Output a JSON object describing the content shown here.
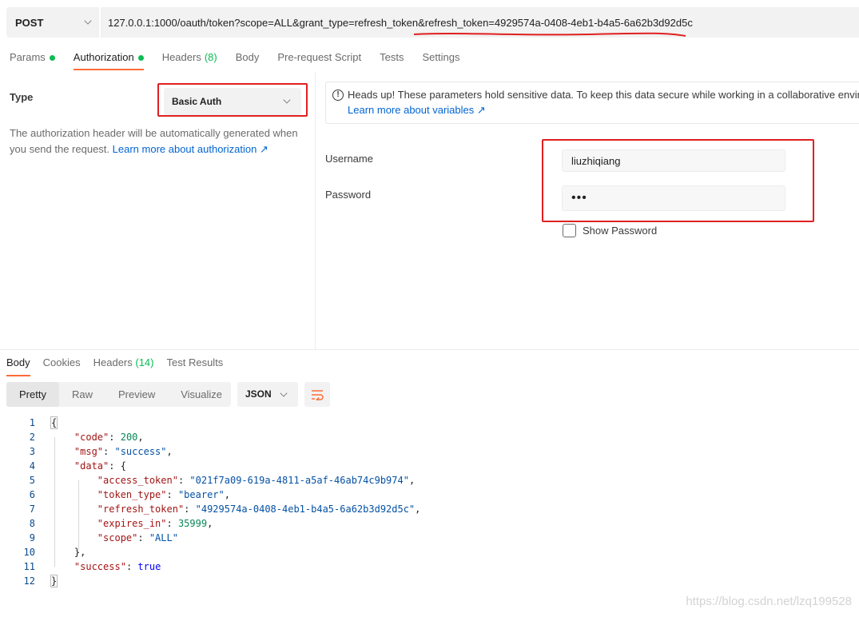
{
  "request": {
    "method": "POST",
    "url": "127.0.0.1:1000/oauth/token?scope=ALL&grant_type=refresh_token&refresh_token=4929574a-0408-4eb1-b4a5-6a62b3d92d5c"
  },
  "request_tabs": [
    {
      "label": "Params",
      "dot": true
    },
    {
      "label": "Authorization",
      "dot": true,
      "active": true
    },
    {
      "label": "Headers",
      "count": "(8)"
    },
    {
      "label": "Body"
    },
    {
      "label": "Pre-request Script"
    },
    {
      "label": "Tests"
    },
    {
      "label": "Settings"
    }
  ],
  "auth": {
    "type_label": "Type",
    "type_value": "Basic Auth",
    "description": "The authorization header will be automatically generated when you send the request.",
    "description_link": "Learn more about authorization ↗",
    "notice_text": "Heads up! These parameters hold sensitive data. To keep this data secure while working in a collaborative enviro",
    "notice_link": "Learn more about variables ↗",
    "username_label": "Username",
    "username_value": "liuzhiqiang",
    "password_label": "Password",
    "password_value": "•••",
    "show_password_label": "Show Password"
  },
  "response_tabs": [
    {
      "label": "Body",
      "active": true
    },
    {
      "label": "Cookies"
    },
    {
      "label": "Headers",
      "count": "(14)"
    },
    {
      "label": "Test Results"
    }
  ],
  "response_view": {
    "modes": [
      "Pretty",
      "Raw",
      "Preview",
      "Visualize"
    ],
    "active_mode": "Pretty",
    "format": "JSON"
  },
  "code_lines": [
    {
      "n": "1",
      "t": "{"
    },
    {
      "n": "2",
      "t": "    \"code\": 200,"
    },
    {
      "n": "3",
      "t": "    \"msg\": \"success\","
    },
    {
      "n": "4",
      "t": "    \"data\": {"
    },
    {
      "n": "5",
      "t": "        \"access_token\": \"021f7a09-619a-4811-a5af-46ab74c9b974\","
    },
    {
      "n": "6",
      "t": "        \"token_type\": \"bearer\","
    },
    {
      "n": "7",
      "t": "        \"refresh_token\": \"4929574a-0408-4eb1-b4a5-6a62b3d92d5c\","
    },
    {
      "n": "8",
      "t": "        \"expires_in\": 35999,"
    },
    {
      "n": "9",
      "t": "        \"scope\": \"ALL\""
    },
    {
      "n": "10",
      "t": "    },"
    },
    {
      "n": "11",
      "t": "    \"success\": true"
    },
    {
      "n": "12",
      "t": "}"
    }
  ],
  "watermark": "https://blog.csdn.net/lzq199528",
  "colors": {
    "accent": "#ff6c37",
    "success_dot": "#0cbb52",
    "link": "#0265d2",
    "annotation_red": "#e02020"
  }
}
